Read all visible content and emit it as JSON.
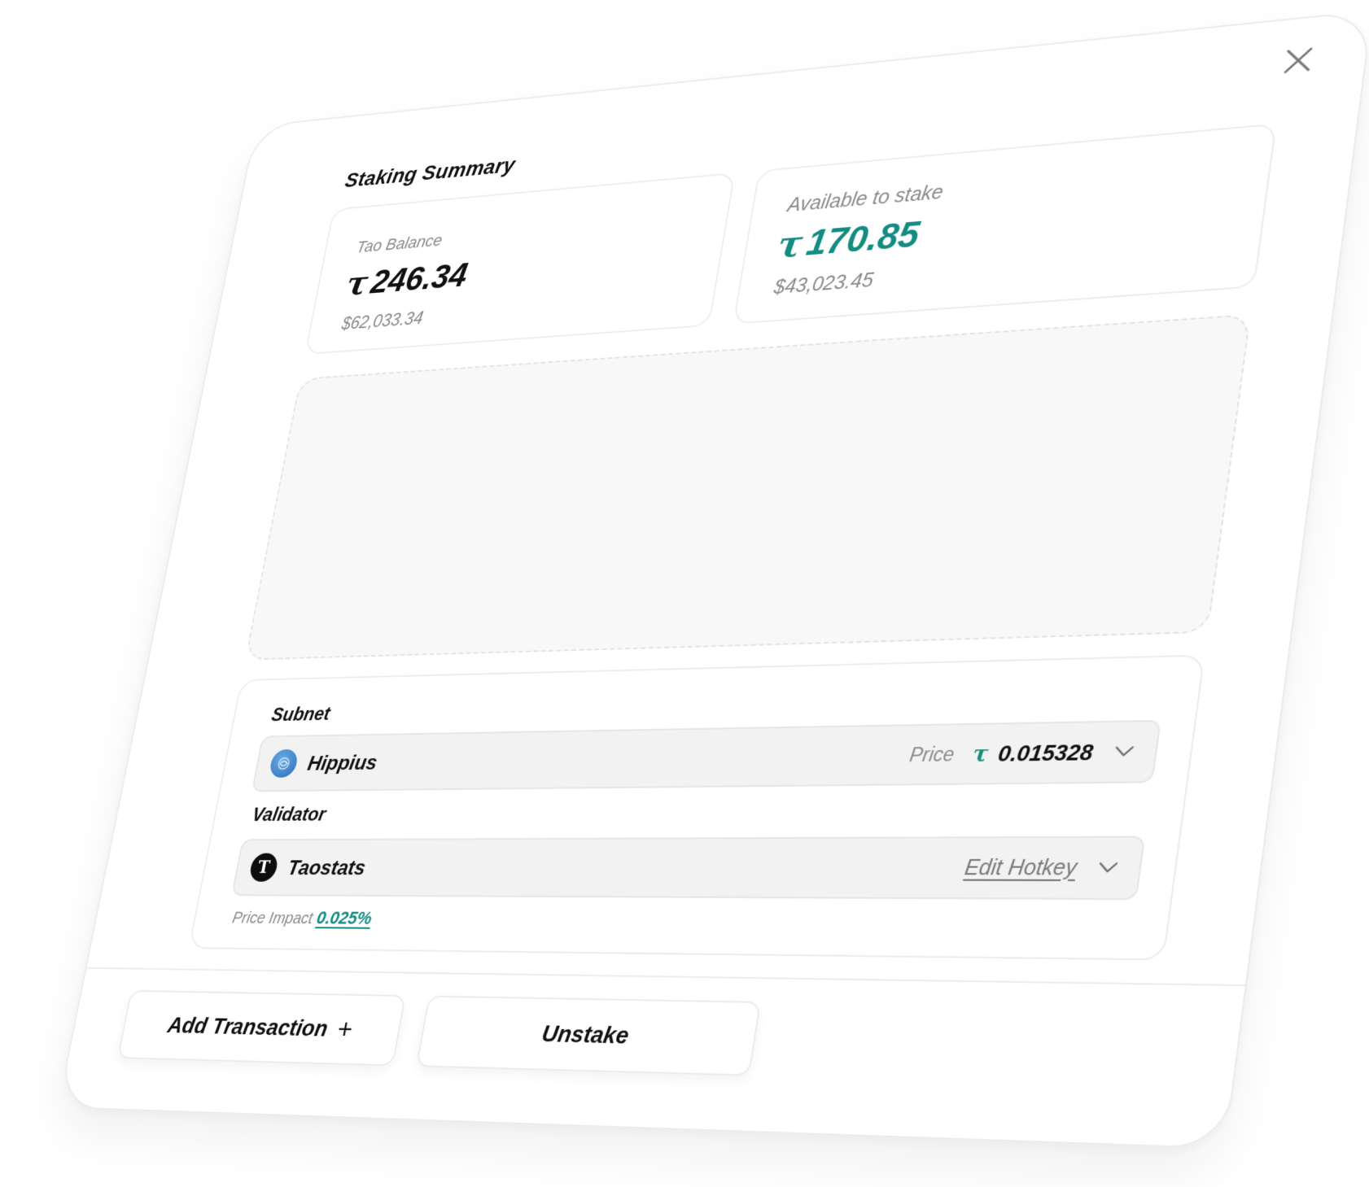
{
  "modal": {
    "title": "Staking Summary",
    "close_label": "close"
  },
  "balance": {
    "label": "Tao Balance",
    "symbol": "τ",
    "amount": "246.34",
    "usd": "$62,033.34"
  },
  "available": {
    "label": "Available to stake",
    "symbol": "τ",
    "amount": "170.85",
    "usd": "$43,023.45"
  },
  "form": {
    "subnet_label": "Subnet",
    "subnet": {
      "name": "Hippius",
      "price_label": "Price",
      "price_symbol": "τ",
      "price_value": "0.015328"
    },
    "validator_label": "Validator",
    "validator": {
      "icon_letter": "T",
      "name": "Taostats",
      "edit_label": "Edit Hotkey"
    },
    "impact_label": "Price Impact",
    "impact_value": "0.025%"
  },
  "actions": {
    "add_label": "Add Transaction",
    "add_symbol": "+",
    "unstake_label": "Unstake"
  },
  "colors": {
    "accent": "#158c82",
    "muted": "#8a8a8a",
    "text": "#111111",
    "field_bg": "#f2f2f2"
  }
}
